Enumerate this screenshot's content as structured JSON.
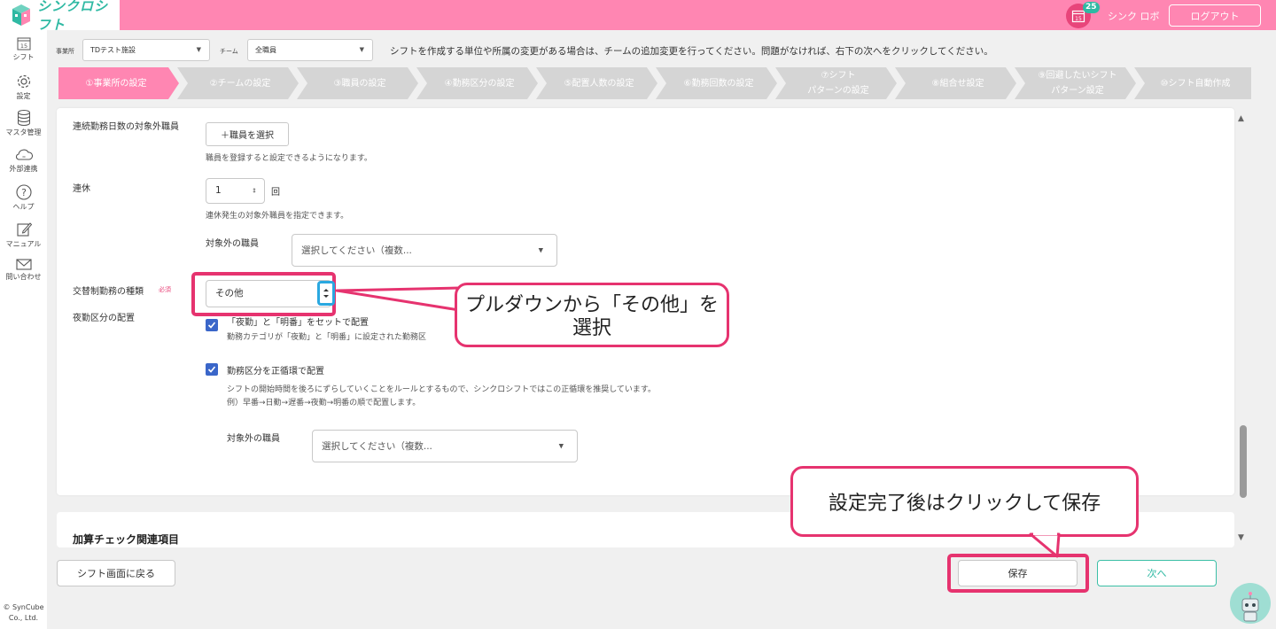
{
  "header": {
    "app_name": "シンクロシフト",
    "notification_count": "25",
    "calendar_day": "15",
    "user_name": "シンク ロボ",
    "logout_label": "ログアウト"
  },
  "sidebar": {
    "items": [
      {
        "label": "シフト",
        "icon": "calendar-icon"
      },
      {
        "label": "設定",
        "icon": "gear-icon"
      },
      {
        "label": "マスタ管理",
        "icon": "database-icon"
      },
      {
        "label": "外部連携",
        "icon": "cloud-icon"
      },
      {
        "label": "ヘルプ",
        "icon": "help-icon"
      },
      {
        "label": "マニュアル",
        "icon": "edit-icon"
      },
      {
        "label": "問い合わせ",
        "icon": "mail-icon"
      }
    ],
    "copyright": [
      "© SynCube",
      "Co., Ltd."
    ]
  },
  "filters": {
    "office_label": "事業所",
    "office_value": "TDテスト施設",
    "team_label": "チーム",
    "team_value": "全職員",
    "note": "シフトを作成する単位や所属の変更がある場合は、チームの追加変更を行ってください。問題がなければ、右下の次へをクリックしてください。"
  },
  "steps": [
    {
      "label": "①事業所の設定",
      "active": true
    },
    {
      "label": "②チームの設定",
      "active": false
    },
    {
      "label": "③職員の設定",
      "active": false
    },
    {
      "label": "④勤務区分の設定",
      "active": false
    },
    {
      "label": "⑤配置人数の設定",
      "active": false
    },
    {
      "label": "⑥勤務回数の設定",
      "active": false
    },
    {
      "label": "⑦シフト",
      "label2": "パターンの設定",
      "active": false
    },
    {
      "label": "⑧組合せ設定",
      "active": false
    },
    {
      "label": "⑨回避したいシフト",
      "label2": "パターン設定",
      "active": false
    },
    {
      "label": "⑩シフト自動作成",
      "active": false
    }
  ],
  "form": {
    "consecutive_excluded_label": "連続勤務日数の対象外職員",
    "select_staff_button": "＋職員を選択",
    "select_staff_hint": "職員を登録すると設定できるようになります。",
    "renkyu_label": "連休",
    "renkyu_value": "1",
    "renkyu_unit": "回",
    "renkyu_hint": "連休発生の対象外職員を指定できます。",
    "excluded_staff_label": "対象外の職員",
    "excluded_staff_placeholder": "選択してください（複数...",
    "shift_type_label": "交替制勤務の種類",
    "required_badge": "必須",
    "shift_type_value": "その他",
    "night_label": "夜勤区分の配置",
    "night_set_label": "「夜勤」と「明番」をセットで配置",
    "night_set_hint": "勤務カテゴリが「夜勤」と「明番」に設定された勤務区",
    "rotation_label": "勤務区分を正循環で配置",
    "rotation_hint_1": "シフトの開始時間を後ろにずらしていくことをルールとするもので、シンクロシフトではこの正循環を推奨しています。",
    "rotation_hint_2": "例）早番→日勤→遅番→夜勤→明番の順で配置します。",
    "excluded_staff_label_2": "対象外の職員",
    "excluded_staff_placeholder_2": "選択してください（複数..."
  },
  "section2": {
    "title": "加算チェック関連項目"
  },
  "footer": {
    "back_label": "シフト画面に戻る",
    "save_label": "保存",
    "next_label": "次へ"
  },
  "annotations": {
    "callout_1_line1": "プルダウンから「その他」を",
    "callout_1_line2": "選択",
    "callout_2": "設定完了後はクリックして保存",
    "highlight_color": "#e6336f",
    "focus_color": "#2aa8e0"
  },
  "colors": {
    "brand_pink": "#ff86b2",
    "brand_teal": "#2fb9a3",
    "checkbox_blue": "#3a66c9"
  }
}
